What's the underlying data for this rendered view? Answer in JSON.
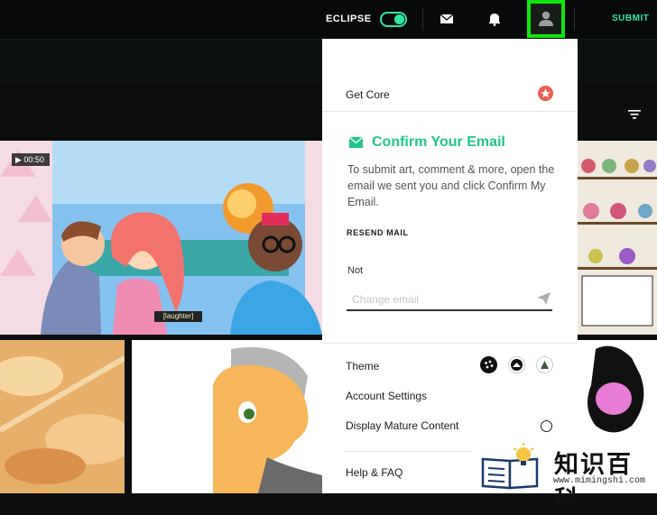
{
  "topbar": {
    "theme_name": "ECLIPSE",
    "submit_label": "SUBMIT",
    "accent": "#2ee8a0",
    "highlight": "#14e30f"
  },
  "content": {
    "video_duration": "00:50",
    "caption": "[laughter]"
  },
  "menu": {
    "get_core": "Get Core",
    "confirm_title": "Confirm Your Email",
    "confirm_text": "To submit art, comment & more, open the email we sent you and click Confirm My Email.",
    "resend": "RESEND MAIL",
    "not_label": "Not",
    "email_placeholder": "Change email",
    "theme": "Theme",
    "account_settings": "Account Settings",
    "display_mature": "Display Mature Content",
    "help": "Help & FAQ"
  },
  "watermark": {
    "text": "知识百科",
    "url": "www.mimingshi.com"
  }
}
